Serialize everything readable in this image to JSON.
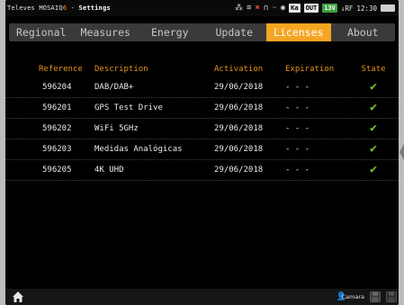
{
  "statusbar": {
    "brand_prefix": "Televes MOSAIQ",
    "brand_q": "6",
    "brand_sep": " - ",
    "title": "Settings",
    "badge_1": "Ka",
    "badge_2": "OUT",
    "badge_3": "13V",
    "rf_label": "↓RF",
    "time": "12:30"
  },
  "tabs": [
    {
      "label": "Regional"
    },
    {
      "label": "Measures"
    },
    {
      "label": "Energy"
    },
    {
      "label": "Update"
    },
    {
      "label": "Licenses"
    },
    {
      "label": "About"
    }
  ],
  "active_tab": "Licenses",
  "table": {
    "headers": {
      "reference": "Reference",
      "description": "Description",
      "activation": "Activation",
      "expiration": "Expiration",
      "state": "State"
    },
    "rows": [
      {
        "reference": "596204",
        "description": "DAB/DAB+",
        "activation": "29/06/2018",
        "expiration": "- - -",
        "state": "active"
      },
      {
        "reference": "596201",
        "description": "GPS Test Drive",
        "activation": "29/06/2018",
        "expiration": "- - -",
        "state": "active"
      },
      {
        "reference": "596202",
        "description": "WiFi 5GHz",
        "activation": "29/06/2018",
        "expiration": "- - -",
        "state": "active"
      },
      {
        "reference": "596203",
        "description": "Medidas Analógicas",
        "activation": "29/06/2018",
        "expiration": "- - -",
        "state": "active"
      },
      {
        "reference": "596205",
        "description": "4K UHD",
        "activation": "29/06/2018",
        "expiration": "- - -",
        "state": "active"
      }
    ]
  },
  "bottombar": {
    "camera_label": "Camara"
  },
  "colors": {
    "accent": "#f5a623",
    "header_text": "#e39420",
    "check": "#72c52b",
    "tab_bg": "#3a3a3a"
  }
}
